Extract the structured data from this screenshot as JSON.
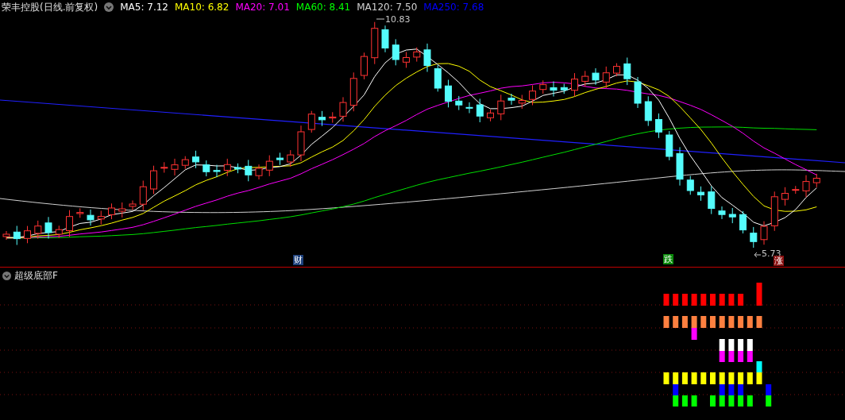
{
  "stock_title": "荣丰控股(日线.前复权)",
  "legend": [
    {
      "text": "MA5: 7.12",
      "color": "#ffffff"
    },
    {
      "text": "MA10: 6.82",
      "color": "#ffff00"
    },
    {
      "text": "MA20: 7.01",
      "color": "#ff00ff"
    },
    {
      "text": "MA60: 8.41",
      "color": "#00ff00"
    },
    {
      "text": "MA120: 7.50",
      "color": "#d0d0d0"
    },
    {
      "text": "MA250: 7.68",
      "color": "#0000ff"
    }
  ],
  "price_high": "10.83",
  "price_low": "5.73",
  "event_tags": [
    {
      "text": "财",
      "color": "#1c3f7a"
    },
    {
      "text": "跌",
      "color": "#0a8a0a"
    },
    {
      "text": "涨",
      "color": "#8a1010"
    }
  ],
  "indicator_title": "超级底部F"
}
